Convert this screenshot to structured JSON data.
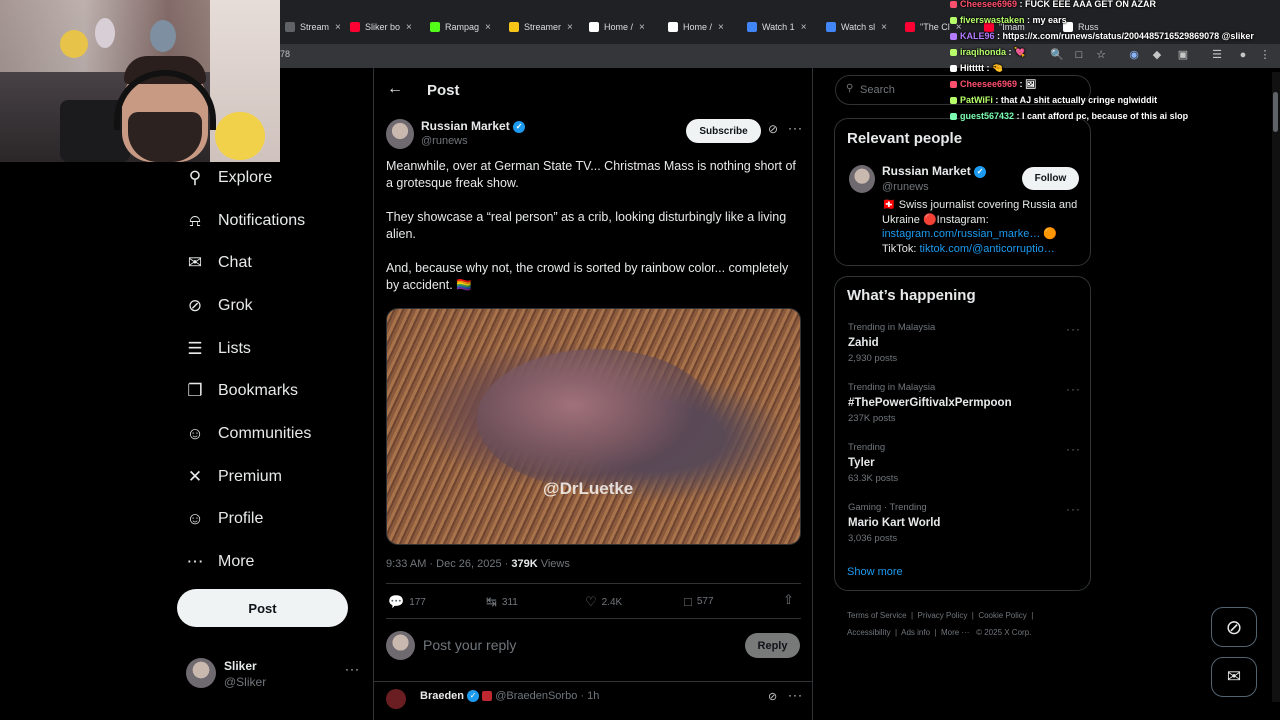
{
  "browser": {
    "tabs": [
      {
        "label": "Stream",
        "color": "#5f6368"
      },
      {
        "label": "Sliker bo",
        "color": "#ff0033"
      },
      {
        "label": "Rampag",
        "color": "#53fc18"
      },
      {
        "label": "Streamer",
        "color": "#f5c518"
      },
      {
        "label": "Home /",
        "color": "#ffffff"
      },
      {
        "label": "Home /",
        "color": "#ffffff"
      },
      {
        "label": "Watch 1",
        "color": "#4285f4"
      },
      {
        "label": "Watch sl",
        "color": "#4285f4"
      },
      {
        "label": "\"The Cl",
        "color": "#ff0033"
      },
      {
        "label": "\"Imam",
        "color": "#ff0033"
      },
      {
        "label": "Russ",
        "color": "#ffffff"
      }
    ],
    "address": "78"
  },
  "sidebar": {
    "items": [
      {
        "label": "Explore",
        "icon": "search-icon"
      },
      {
        "label": "Notifications",
        "icon": "bell-icon"
      },
      {
        "label": "Chat",
        "icon": "mail-icon"
      },
      {
        "label": "Grok",
        "icon": "grok-icon"
      },
      {
        "label": "Lists",
        "icon": "list-icon"
      },
      {
        "label": "Bookmarks",
        "icon": "bookmark-icon"
      },
      {
        "label": "Communities",
        "icon": "people-icon"
      },
      {
        "label": "Premium",
        "icon": "x-logo-icon"
      },
      {
        "label": "Profile",
        "icon": "person-icon"
      },
      {
        "label": "More",
        "icon": "more-circle-icon"
      }
    ],
    "post_button": "Post",
    "account": {
      "name": "Sliker",
      "handle": "@Sliker"
    }
  },
  "main": {
    "header": "Post",
    "author": {
      "name": "Russian Market",
      "handle": "@runews"
    },
    "subscribe_label": "Subscribe",
    "paragraphs": [
      "Meanwhile, over at German State TV... Christmas Mass is nothing short of a grotesque freak show.",
      "They showcase a “real person” as a crib, looking disturbingly like a living alien.",
      "And, because why not, the crowd is sorted by rainbow color... completely by accident. 🏳️‍🌈"
    ],
    "media_watermark": "@DrLuetke",
    "meta": {
      "time": "9:33 AM · Dec 26, 2025 · ",
      "views": "379K",
      "views_label": " Views"
    },
    "stats": {
      "replies": "177",
      "reposts": "311",
      "likes": "2.4K",
      "bookmarks": "577"
    },
    "reply_placeholder": "Post your reply",
    "reply_button": "Reply",
    "next_reply": {
      "name": "Braeden",
      "handle": "@BraedenSorbo",
      "time": "· 1h"
    }
  },
  "right": {
    "search_placeholder": "Search",
    "relevant_title": "Relevant people",
    "person": {
      "name": "Russian Market",
      "handle": "@runews",
      "follow_label": "Follow",
      "bio_prefix": "🇨🇭 Swiss journalist covering Russia and Ukraine 🔴Instagram:",
      "bio_link1": "instagram.com/russian_marke…",
      "bio_emoji": "🟠",
      "bio_tiktok": "TikTok: ",
      "bio_link2": "tiktok.com/@anticorruptio…"
    },
    "happening_title": "What’s happening",
    "trends": [
      {
        "context": "Trending in Malaysia",
        "name": "Zahid",
        "posts": "2,930 posts"
      },
      {
        "context": "Trending in Malaysia",
        "name": "#ThePowerGiftivalxPermpoon",
        "posts": "237K posts"
      },
      {
        "context": "Trending",
        "name": "Tyler",
        "posts": "63.3K posts"
      },
      {
        "context": "Gaming · Trending",
        "name": "Mario Kart World",
        "posts": "3,036 posts"
      }
    ],
    "show_more": "Show more",
    "footer": [
      "Terms of Service",
      "Privacy Policy",
      "Cookie Policy",
      "Accessibility",
      "Ads info",
      "More ···",
      "© 2025 X Corp."
    ]
  },
  "chat": [
    {
      "user": "Cheesee6969",
      "msg": "FUCK EEE AAA GET ON AZAR",
      "color": "#ff4f6e"
    },
    {
      "user": "fiverswastaken",
      "msg": "my ears",
      "color": "#b6ff6b"
    },
    {
      "user": "KALE96",
      "msg": "https://x.com/runews/status/2004485716529869078 @sliker",
      "color": "#b37bff"
    },
    {
      "user": "iraqihonda",
      "msg": "💘",
      "color": "#b6ff6b"
    },
    {
      "user": "Hittttt",
      "msg": "🤏",
      "color": "#ffffff"
    },
    {
      "user": "Cheesee6969",
      "msg": "🖼",
      "color": "#ff4f6e"
    },
    {
      "user": "PatWiFi",
      "msg": "that AJ shit actually cringe nglwiddit",
      "color": "#b6ff6b"
    },
    {
      "user": "guest567432",
      "msg": "I cant afford pc, because of this ai slop",
      "color": "#7bffb0"
    }
  ]
}
